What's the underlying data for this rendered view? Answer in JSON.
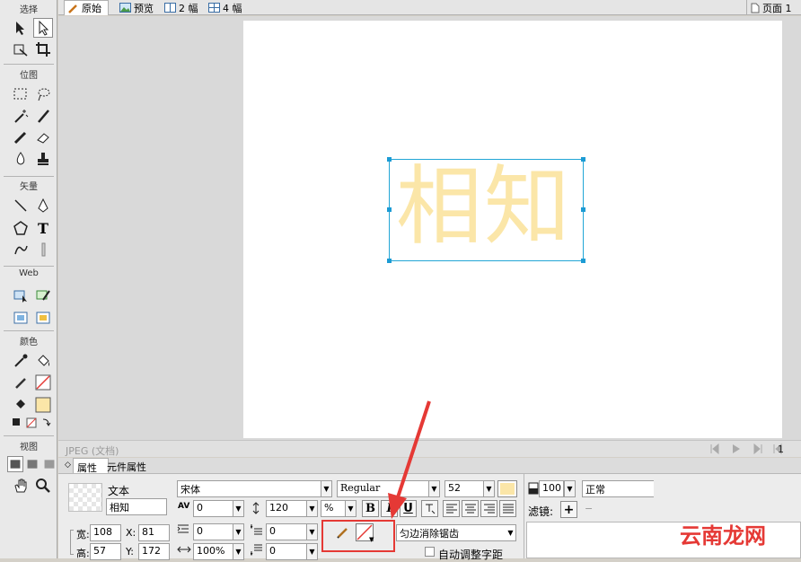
{
  "toolbar": {
    "sections": {
      "select": "选择",
      "bitmap": "位图",
      "vector": "矢量",
      "web": "Web",
      "colors": "颜色",
      "view": "视图"
    },
    "text_tool_glyph": "T"
  },
  "tabs": [
    {
      "label": "原始",
      "icon": "pencil-icon",
      "active": true
    },
    {
      "label": "预览",
      "icon": "image-icon",
      "active": false
    },
    {
      "label": "2 幅",
      "icon": "two-pane-icon",
      "active": false
    },
    {
      "label": "4 幅",
      "icon": "four-pane-icon",
      "active": false
    }
  ],
  "page_selector": {
    "label": "页面 1"
  },
  "canvas": {
    "text": "相知",
    "text_color": "#fbe6a8",
    "selection_color": "#22a6d6"
  },
  "status": {
    "doc_label": "JPEG (文档)",
    "frame_number": "1"
  },
  "properties": {
    "tabs": [
      "属性",
      "元件属性"
    ],
    "object_type": "文本",
    "object_name": "相知",
    "width_label": "宽:",
    "width_value": "108",
    "height_label": "高:",
    "height_value": "57",
    "x_label": "X:",
    "x_value": "81",
    "y_label": "Y:",
    "y_value": "172",
    "font": "宋体",
    "style": "Regular",
    "size": "52",
    "fill_color": "#fbe6a8",
    "kerning": "0",
    "leading": "120",
    "leading_unit": "%",
    "indent": "0",
    "space_before": "0",
    "scale": "100%",
    "space_after": "0",
    "bold_label": "B",
    "italic_label": "I",
    "underline_label": "U",
    "antialias": "匀边消除锯齿",
    "auto_kern": "自动调整字距",
    "opacity": "100",
    "blend_mode": "正常",
    "filters_label": "滤镜:",
    "add_filter_label": "+",
    "remove_filter_label": "−"
  },
  "watermark": "云南龙网",
  "accent_red": "#e53935"
}
